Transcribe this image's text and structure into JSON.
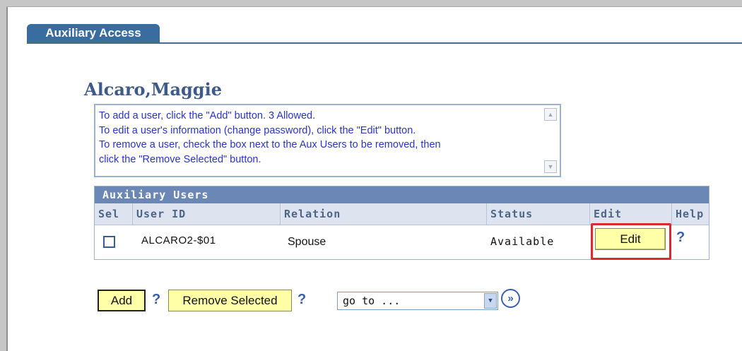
{
  "tab": {
    "label": "Auxiliary Access"
  },
  "person": {
    "name": "Alcaro,Maggie"
  },
  "instructions": {
    "lines": [
      "To add a user, click the \"Add\" button.  3 Allowed.",
      "To edit a user's information (change password), click the \"Edit\" button.",
      "To remove a user, check the box next to the Aux Users to be removed, then",
      "click the \"Remove Selected\" button."
    ]
  },
  "grid": {
    "title": "Auxiliary Users",
    "columns": [
      "Sel",
      "User ID",
      "Relation",
      "Status",
      "Edit",
      "Help"
    ],
    "rows": [
      {
        "selected": false,
        "user_id": "ALCARO2-$01",
        "relation": "Spouse",
        "status": "Available",
        "edit_label": "Edit",
        "help_label": "?"
      }
    ]
  },
  "actions": {
    "add_label": "Add",
    "remove_label": "Remove Selected",
    "help_label": "?",
    "goto_value": "go to ...",
    "go_button": "»"
  },
  "colors": {
    "tab_bg": "#3a6d9f",
    "grid_title_bg": "#6b87b5",
    "button_yellow": "#ffffa8",
    "highlight_red": "#e0262e",
    "instruction_text": "#2a35c8"
  }
}
